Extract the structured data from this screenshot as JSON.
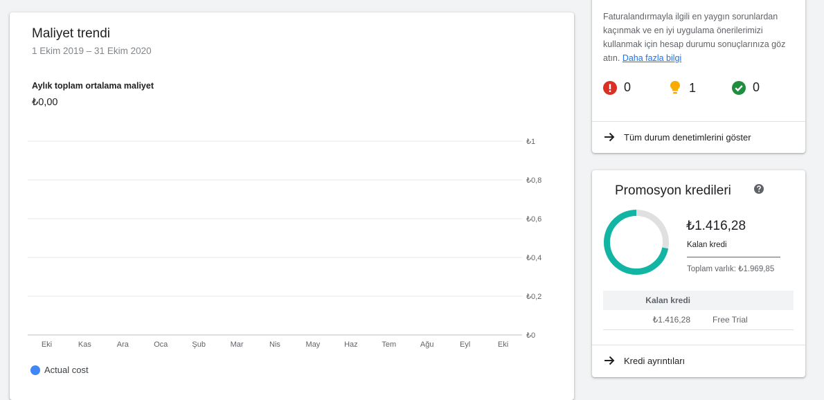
{
  "trend": {
    "title": "Maliyet trendi",
    "date_range": "1 Ekim 2019 – 31 Ekim 2020",
    "metric_label": "Aylık toplam ortalama maliyet",
    "metric_value": "₺0,00",
    "legend_label": "Actual cost"
  },
  "chart_data": {
    "type": "line",
    "categories": [
      "Eki",
      "Kas",
      "Ara",
      "Oca",
      "Şub",
      "Mar",
      "Nis",
      "May",
      "Haz",
      "Tem",
      "Ağu",
      "Eyl",
      "Eki"
    ],
    "series": [
      {
        "name": "Actual cost",
        "values": [
          0,
          0,
          0,
          0,
          0,
          0,
          0,
          0,
          0,
          0,
          0,
          0,
          0
        ],
        "color": "#4285f4"
      }
    ],
    "y_ticks": [
      "₺1",
      "₺0,8",
      "₺0,6",
      "₺0,4",
      "₺0,2",
      "₺0"
    ],
    "ylim": [
      0,
      1
    ],
    "grid": true,
    "y_axis_side": "right",
    "legend_position": "bottom-left",
    "title": "",
    "xlabel": "",
    "ylabel": ""
  },
  "status": {
    "description": "Faturalandırmayla ilgili en yaygın sorunlardan kaçınmak ve en iyi uygulama önerilerimizi kullanmak için hesap durumu sonuçlarınıza göz atın.",
    "learn_more": "Daha fazla bilgi",
    "error_count": "0",
    "warning_count": "1",
    "ok_count": "0",
    "show_all_label": "Tüm durum denetimlerini göster",
    "colors": {
      "error": "#d93025",
      "warning": "#f9ab00",
      "ok": "#1e8e3e"
    }
  },
  "promo": {
    "title": "Promosyon kredileri",
    "remaining_value": "₺1.416,28",
    "remaining_label": "Kalan kredi",
    "total_label": "Toplam varlık: ₺1.969,85",
    "remaining_fraction": 0.719,
    "table_header": "Kalan kredi",
    "table_rows": [
      {
        "amount": "₺1.416,28",
        "name": "Free Trial"
      }
    ],
    "details_label": "Kredi ayrıntıları",
    "colors": {
      "accent": "#12b5a3",
      "track": "#e0e0e0"
    }
  }
}
